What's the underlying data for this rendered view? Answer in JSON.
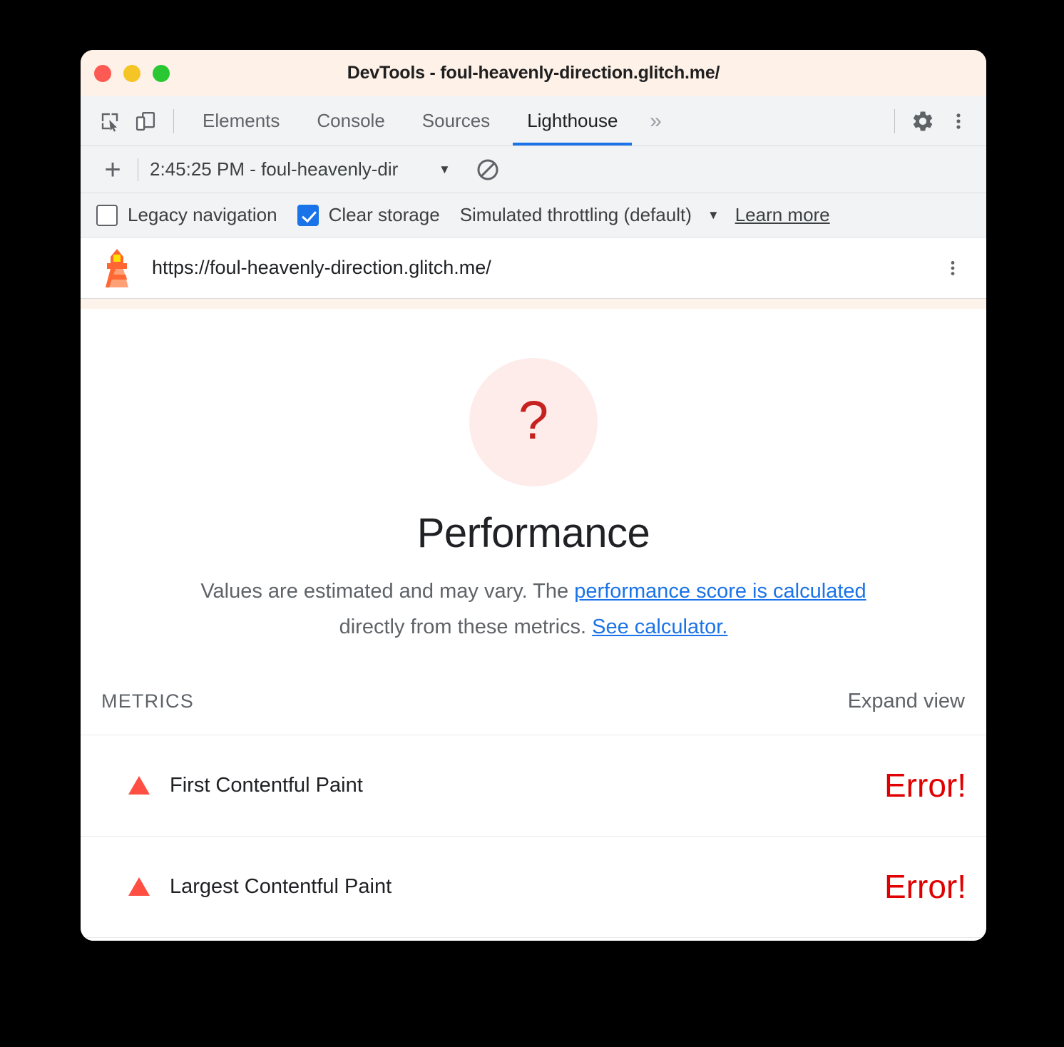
{
  "window": {
    "title": "DevTools - foul-heavenly-direction.glitch.me/",
    "traffic_lights": [
      "close",
      "minimize",
      "zoom"
    ]
  },
  "tabbar": {
    "inspect_icon": "inspect-element-icon",
    "device_icon": "device-toolbar-icon",
    "tabs": [
      {
        "label": "Elements",
        "active": false
      },
      {
        "label": "Console",
        "active": false
      },
      {
        "label": "Sources",
        "active": false
      },
      {
        "label": "Lighthouse",
        "active": true
      }
    ],
    "more_tabs": "»",
    "settings_icon": "gear-icon",
    "menu_icon": "kebab-menu-icon",
    "active_underline_color": "#1a73e8"
  },
  "runbar": {
    "new_report_label": "+",
    "selected_run": "2:45:25 PM - foul-heavenly-dir",
    "caret": "▼",
    "clear_icon": "no-entry-icon"
  },
  "settings": {
    "legacy_navigation": {
      "label": "Legacy navigation",
      "checked": false
    },
    "clear_storage": {
      "label": "Clear storage",
      "checked": true
    },
    "throttling": {
      "label": "Simulated throttling (default)",
      "caret": "▼"
    },
    "learn_more": "Learn more",
    "accent_color": "#1a73e8"
  },
  "urlbar": {
    "lighthouse_icon": "lighthouse-icon",
    "url": "https://foul-heavenly-direction.glitch.me/",
    "menu_icon": "kebab-menu-icon"
  },
  "report": {
    "gauge": {
      "value": "?",
      "color": "#c5221f",
      "background": "#fdecea"
    },
    "category_title": "Performance",
    "description": {
      "part1": "Values are estimated and may vary. The ",
      "link1": "performance score is calculated",
      "part2": " directly from these metrics. ",
      "link2": "See calculator.",
      "link_color": "#1a73e8"
    },
    "metrics_header": {
      "title": "METRICS",
      "expand_view": "Expand view"
    },
    "metrics": [
      {
        "icon": "warning-triangle-icon",
        "name": "First Contentful Paint",
        "value": "Error!",
        "status_color": "#ff4e42",
        "value_color": "#e00000"
      },
      {
        "icon": "warning-triangle-icon",
        "name": "Largest Contentful Paint",
        "value": "Error!",
        "status_color": "#ff4e42",
        "value_color": "#e00000"
      }
    ]
  }
}
